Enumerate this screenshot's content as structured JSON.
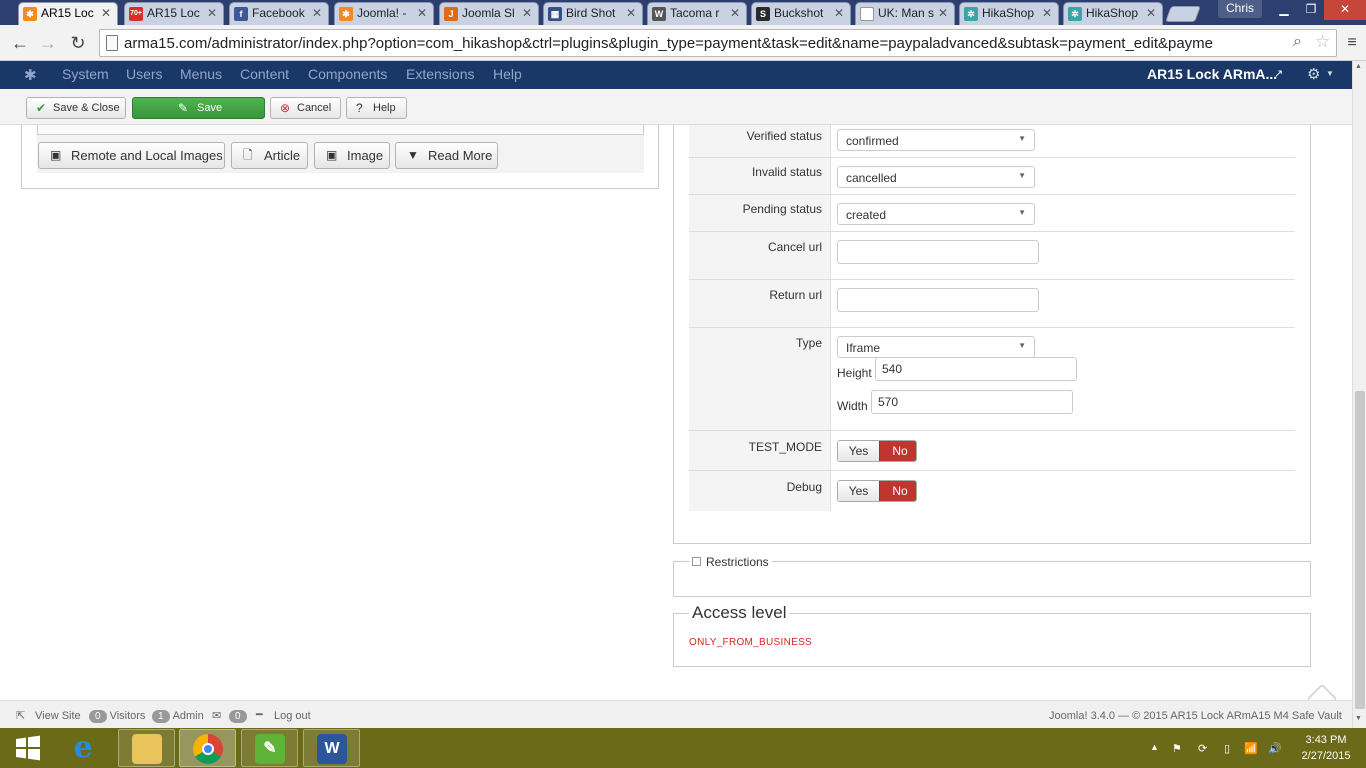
{
  "browser": {
    "tabs": [
      {
        "label": "AR15 Loc",
        "icon": "joomla-favicon",
        "active": true
      },
      {
        "label": "AR15 Loc",
        "icon": "gmail-favicon",
        "badge": "70+"
      },
      {
        "label": "Facebook",
        "icon": "facebook-favicon"
      },
      {
        "label": "Joomla! -",
        "icon": "joomla-favicon"
      },
      {
        "label": "Joomla Sl",
        "icon": "slideshow-favicon"
      },
      {
        "label": "Bird Shot",
        "icon": "table-favicon"
      },
      {
        "label": "Tacoma r",
        "icon": "wolf-favicon"
      },
      {
        "label": "Buckshot",
        "icon": "s-favicon"
      },
      {
        "label": "UK: Man s",
        "icon": "blank-favicon"
      },
      {
        "label": "HikaShop",
        "icon": "hikashop-favicon"
      },
      {
        "label": "HikaShop",
        "icon": "hikashop-favicon"
      }
    ],
    "user": "Chris",
    "url": "arma15.com/administrator/index.php?option=com_hikashop&ctrl=plugins&plugin_type=payment&task=edit&name=paypaladvanced&subtask=payment_edit&payme"
  },
  "joomla": {
    "menu": [
      "System",
      "Users",
      "Menus",
      "Content",
      "Components",
      "Extensions",
      "Help"
    ],
    "site_name": "AR15 Lock ARmA...",
    "toolbar": {
      "save_close": "Save & Close",
      "save": "Save",
      "cancel": "Cancel",
      "help": "Help"
    }
  },
  "editor": {
    "buttons": [
      "Remote and Local Images",
      "Article",
      "Image",
      "Read More"
    ]
  },
  "form": {
    "verified_label": "Verified status",
    "verified_value": "confirmed",
    "invalid_label": "Invalid status",
    "invalid_value": "cancelled",
    "pending_label": "Pending status",
    "pending_value": "created",
    "cancel_url_label": "Cancel url",
    "cancel_url_value": "",
    "return_url_label": "Return url",
    "return_url_value": "",
    "type_label": "Type",
    "type_value": "Iframe",
    "height_label": "Height",
    "height_value": "540",
    "width_label": "Width",
    "width_value": "570",
    "test_mode_label": "TEST_MODE",
    "debug_label": "Debug",
    "yes": "Yes",
    "no": "No"
  },
  "restrictions": {
    "label": "Restrictions"
  },
  "access": {
    "title": "Access level",
    "value": "ONLY_FROM_BUSINESS"
  },
  "footer": {
    "view_site": "View Site",
    "visitors_count": "0",
    "visitors": "Visitors",
    "admin_count": "1",
    "admin": "Admin",
    "messages_count": "0",
    "logout": "Log out",
    "copyright": "Joomla! 3.4.0  —  © 2015 AR15 Lock ARmA15 M4 Safe Vault"
  },
  "taskbar": {
    "time": "3:43 PM",
    "date": "2/27/2015"
  },
  "colors": {
    "joomla_nav": "#1a3867",
    "save_green": "#3a963a",
    "no_red": "#bd362f",
    "access_text": "#d9261c",
    "taskbar": "#6b6a18"
  }
}
